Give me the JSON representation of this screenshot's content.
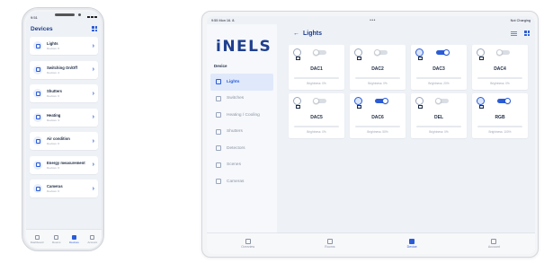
{
  "phone": {
    "status": {
      "time": "9:51"
    },
    "title": "Devices",
    "items": [
      {
        "label": "Lights",
        "sub": "Devices: 6"
      },
      {
        "label": "Switching On/Off",
        "sub": "Devices: 4"
      },
      {
        "label": "Shutters",
        "sub": "Devices: 6"
      },
      {
        "label": "Heating",
        "sub": "Devices: 3"
      },
      {
        "label": "Air condition",
        "sub": "Devices: 6"
      },
      {
        "label": "Energy measurement",
        "sub": "Devices: 6"
      },
      {
        "label": "Cameras",
        "sub": "Devices: 6"
      }
    ],
    "chevron": "›",
    "nav": [
      {
        "label": "Dashboard"
      },
      {
        "label": "Rooms"
      },
      {
        "label": "Devices",
        "active": true
      },
      {
        "label": "Account"
      }
    ]
  },
  "tablet": {
    "status": {
      "time": "9:55  Mon 16. 8.",
      "right": "Not Charging",
      "dots": "•••"
    },
    "logo": "iNELS",
    "sidebar": {
      "heading": "Device",
      "items": [
        {
          "label": "Lights",
          "active": true
        },
        {
          "label": "Switches"
        },
        {
          "label": "Heating / Cooling"
        },
        {
          "label": "Shutters"
        },
        {
          "label": "Detectors"
        },
        {
          "label": "Scenes"
        },
        {
          "label": "Cameras"
        }
      ]
    },
    "header": {
      "back": "←",
      "title": "Lights"
    },
    "cards": [
      {
        "name": "DAC1",
        "on": false,
        "brightness": "Brightness: 0%",
        "level": 0
      },
      {
        "name": "DAC2",
        "on": false,
        "brightness": "Brightness: 0%",
        "level": 0
      },
      {
        "name": "DAC3",
        "on": true,
        "brightness": "Brightness: 20%",
        "level": 0.2
      },
      {
        "name": "DAC4",
        "on": false,
        "brightness": "Brightness: 0%",
        "level": 0
      },
      {
        "name": "DAC5",
        "on": false,
        "brightness": "Brightness: 0%",
        "level": 0
      },
      {
        "name": "DAC6",
        "on": true,
        "brightness": "Brightness: 50%",
        "level": 0.5
      },
      {
        "name": "DEL",
        "on": false,
        "brightness": "Brightness: 0%",
        "level": 0
      },
      {
        "name": "RGB",
        "on": true,
        "brightness": "Brightness: 100%",
        "level": 1.0
      }
    ],
    "nav": [
      {
        "label": "Overview"
      },
      {
        "label": "Rooms"
      },
      {
        "label": "Device",
        "active": true
      },
      {
        "label": "Account"
      }
    ]
  },
  "colors": {
    "accent": "#2a5bd7",
    "brand": "#1f3f8f",
    "brightness_bar": "#f1b70f"
  }
}
